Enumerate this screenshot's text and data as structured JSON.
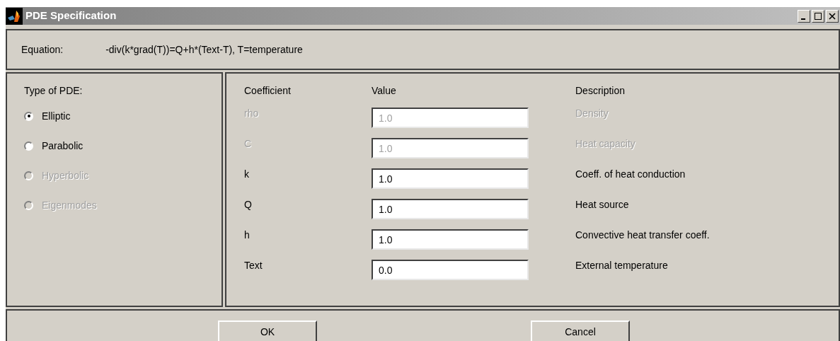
{
  "window": {
    "title": "PDE Specification"
  },
  "equation": {
    "label": "Equation:",
    "text": "-div(k*grad(T))=Q+h*(Text-T), T=temperature"
  },
  "pde_type": {
    "label": "Type of PDE:",
    "options": [
      {
        "label": "Elliptic",
        "selected": true,
        "disabled": false
      },
      {
        "label": "Parabolic",
        "selected": false,
        "disabled": false
      },
      {
        "label": "Hyperbolic",
        "selected": false,
        "disabled": true
      },
      {
        "label": "Eigenmodes",
        "selected": false,
        "disabled": true
      }
    ]
  },
  "table": {
    "columns": [
      "Coefficient",
      "Value",
      "Description"
    ],
    "rows": [
      {
        "coefficient": "rho",
        "value": "1.0",
        "description": "Density",
        "disabled": true
      },
      {
        "coefficient": "C",
        "value": "1.0",
        "description": "Heat capacity",
        "disabled": true
      },
      {
        "coefficient": "k",
        "value": "1.0",
        "description": "Coeff. of heat conduction",
        "disabled": false
      },
      {
        "coefficient": "Q",
        "value": "1.0",
        "description": "Heat source",
        "disabled": false
      },
      {
        "coefficient": "h",
        "value": "1.0",
        "description": "Convective heat transfer coeff.",
        "disabled": false
      },
      {
        "coefficient": "Text",
        "value": "0.0",
        "description": "External temperature",
        "disabled": false
      }
    ]
  },
  "buttons": [
    "OK",
    "Cancel"
  ]
}
